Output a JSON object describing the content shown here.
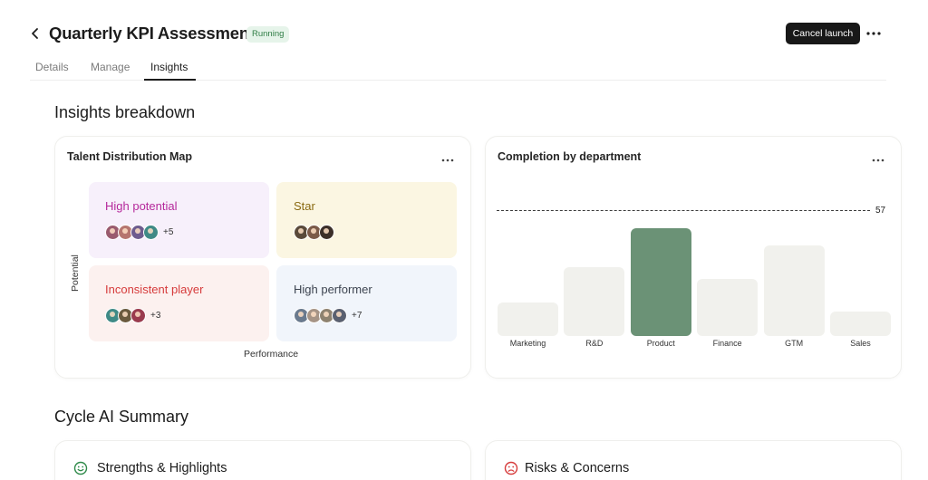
{
  "header": {
    "title": "Quarterly KPI Assessment",
    "status": "Running",
    "cancel_label": "Cancel launch",
    "back_icon": "chevron-left-icon",
    "more_icon": "more-horizontal-icon"
  },
  "tabs": [
    {
      "label": "Details",
      "active": false
    },
    {
      "label": "Manage",
      "active": false
    },
    {
      "label": "Insights",
      "active": true
    }
  ],
  "insights": {
    "title": "Insights breakdown",
    "talent_map": {
      "title": "Talent Distribution Map",
      "y_axis": "Potential",
      "x_axis": "Performance",
      "quadrants": [
        {
          "label": "High potential",
          "color": "#b5299b",
          "bg": "#f7f0fb",
          "avatars": 4,
          "more": "+5"
        },
        {
          "label": "Star",
          "color": "#8a6a12",
          "bg": "#fbf6e2",
          "avatars": 3,
          "more": ""
        },
        {
          "label": "Inconsistent player",
          "color": "#d63b3b",
          "bg": "#fcf1ef",
          "avatars": 3,
          "more": "+3"
        },
        {
          "label": "High performer",
          "color": "#3d4450",
          "bg": "#f1f5fb",
          "avatars": 4,
          "more": "+7"
        }
      ]
    },
    "completion": {
      "title": "Completion by department",
      "reference_value": "57"
    }
  },
  "chart_data": {
    "type": "bar",
    "title": "Completion by department",
    "categories": [
      "Marketing",
      "R&D",
      "Product",
      "Finance",
      "GTM",
      "Sales"
    ],
    "values": [
      15,
      31,
      49,
      26,
      41,
      11
    ],
    "reference_line": 57,
    "highlight": "Product",
    "colors": {
      "default": "#f1f1ed",
      "highlight": "#6b9276"
    },
    "ylim": [
      0,
      70
    ],
    "grid": false
  },
  "summary": {
    "title": "Cycle AI Summary",
    "strengths": {
      "title": "Strengths & Highlights",
      "icon": "smile-icon",
      "color": "#2f8a4a"
    },
    "risks": {
      "title": "Risks & Concerns",
      "icon": "frown-icon",
      "color": "#d63b3b"
    }
  }
}
